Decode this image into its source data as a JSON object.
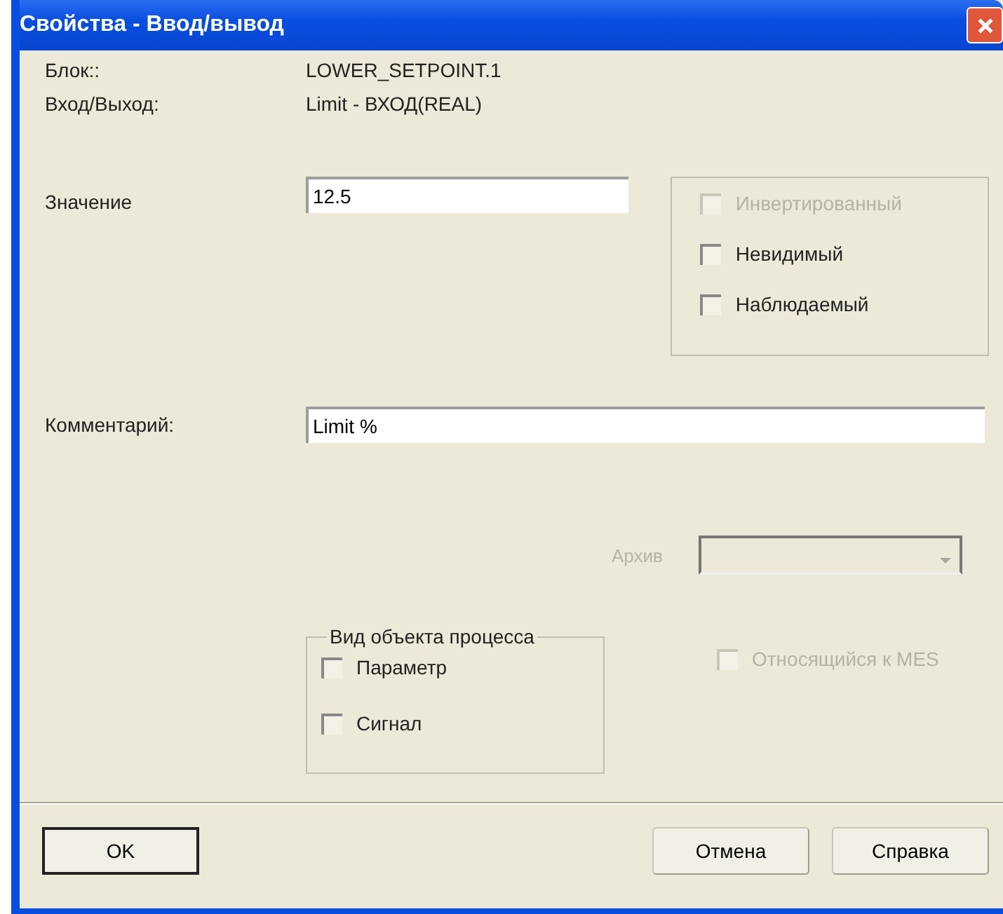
{
  "window": {
    "title": "Свойства - Ввод/вывод"
  },
  "info": [
    {
      "label": "Блок::",
      "value": "LOWER_SETPOINT.1"
    },
    {
      "label": "Вход/Выход:",
      "value": "Limit  -  ВХОД(REAL)"
    }
  ],
  "value_field": {
    "label": "Значение",
    "value": "12.5"
  },
  "flags": [
    {
      "label": "Инвертированный",
      "checked": false,
      "disabled": true
    },
    {
      "label": "Невидимый",
      "checked": false,
      "disabled": false
    },
    {
      "label": "Наблюдаемый",
      "checked": false,
      "disabled": false
    }
  ],
  "comment_field": {
    "label": "Комментарий:",
    "value": "Limit %"
  },
  "archive": {
    "label": "Архив",
    "disabled": true
  },
  "process_object": {
    "title": "Вид объекта процесса",
    "options": [
      {
        "label": "Параметр",
        "checked": false,
        "disabled": false
      },
      {
        "label": "Сигнал",
        "checked": false,
        "disabled": false
      }
    ]
  },
  "mes": {
    "label": "Относящийся к MES",
    "checked": false,
    "disabled": true
  },
  "buttons": [
    {
      "label": "OK",
      "default": true
    },
    {
      "label": "Отмена",
      "default": false
    },
    {
      "label": "Справка",
      "default": false
    }
  ]
}
